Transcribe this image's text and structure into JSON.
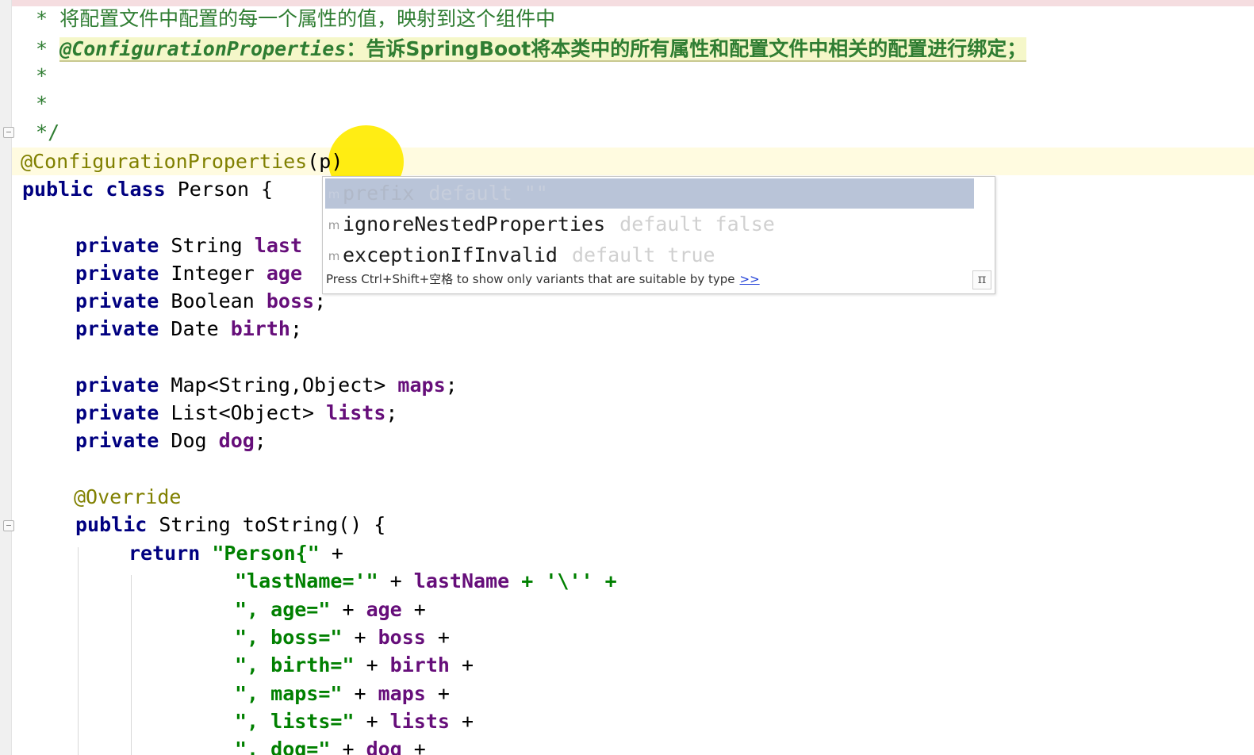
{
  "colors": {
    "keyword": "#000080",
    "field": "#660e7a",
    "string": "#008000",
    "annotation": "#808000",
    "comment": "#2f7d32",
    "cursor_highlight": "#ffec00",
    "popup_selection": "#b9c4d8"
  },
  "code": {
    "doc_line1_star": " * ",
    "doc_line1_text": "将配置文件中配置的每一个属性的值，映射到这个组件中",
    "doc_line2_star": " * ",
    "doc_line2_tag": "@ConfigurationProperties",
    "doc_line2_text": "：告诉SpringBoot将本类中的所有属性和配置文件中相关的配置进行绑定；",
    "doc_line3": " *",
    "doc_line4": " *",
    "doc_line5": " */",
    "annotation_line": "@ConfigurationProperties",
    "annotation_arg": "(p)",
    "class_kw1": "public",
    "class_kw2": "class",
    "class_name": "Person {",
    "fields": [
      {
        "kw": "private",
        "type": "String",
        "name": "last"
      },
      {
        "kw": "private",
        "type": "Integer",
        "name": "age"
      },
      {
        "kw": "private",
        "type": "Boolean",
        "name": "boss",
        "end": ";"
      },
      {
        "kw": "private",
        "type": "Date",
        "name": "birth",
        "end": ";"
      },
      {
        "kw": "private",
        "type": "Map<String,Object>",
        "name": "maps",
        "end": ";"
      },
      {
        "kw": "private",
        "type": "List<Object>",
        "name": "lists",
        "end": ";"
      },
      {
        "kw": "private",
        "type": "Dog",
        "name": "dog",
        "end": ";"
      }
    ],
    "override": "@Override",
    "method_kw": "public",
    "method_sig": "String toString() {",
    "return_kw": "return",
    "return_str": "\"Person{\"",
    "plus": " +",
    "concat": [
      {
        "str": "\"lastName='\"",
        "mid": " + ",
        "field": "lastName",
        "tail": " + '\\'' +"
      },
      {
        "str": "\", age=\"",
        "mid": " + ",
        "field": "age",
        "tail": " +"
      },
      {
        "str": "\", boss=\"",
        "mid": " + ",
        "field": "boss",
        "tail": " +"
      },
      {
        "str": "\", birth=\"",
        "mid": " + ",
        "field": "birth",
        "tail": " +"
      },
      {
        "str": "\", maps=\"",
        "mid": " + ",
        "field": "maps",
        "tail": " +"
      },
      {
        "str": "\", lists=\"",
        "mid": " + ",
        "field": "lists",
        "tail": " +"
      },
      {
        "str": "\", dog=\"",
        "mid": " + ",
        "field": "dog",
        "tail": " +"
      }
    ]
  },
  "popup": {
    "items": [
      {
        "icon": "m",
        "name": "prefix",
        "default": "default \"\"",
        "selected": true
      },
      {
        "icon": "m",
        "name": "ignoreNestedProperties",
        "default": "default false",
        "selected": false
      },
      {
        "icon": "m",
        "name": "exceptionIfInvalid",
        "default": "default true",
        "selected": false
      }
    ],
    "hint": "Press Ctrl+Shift+空格 to show only variants that are suitable by type",
    "hint_link": ">>",
    "pi_button": "π"
  }
}
